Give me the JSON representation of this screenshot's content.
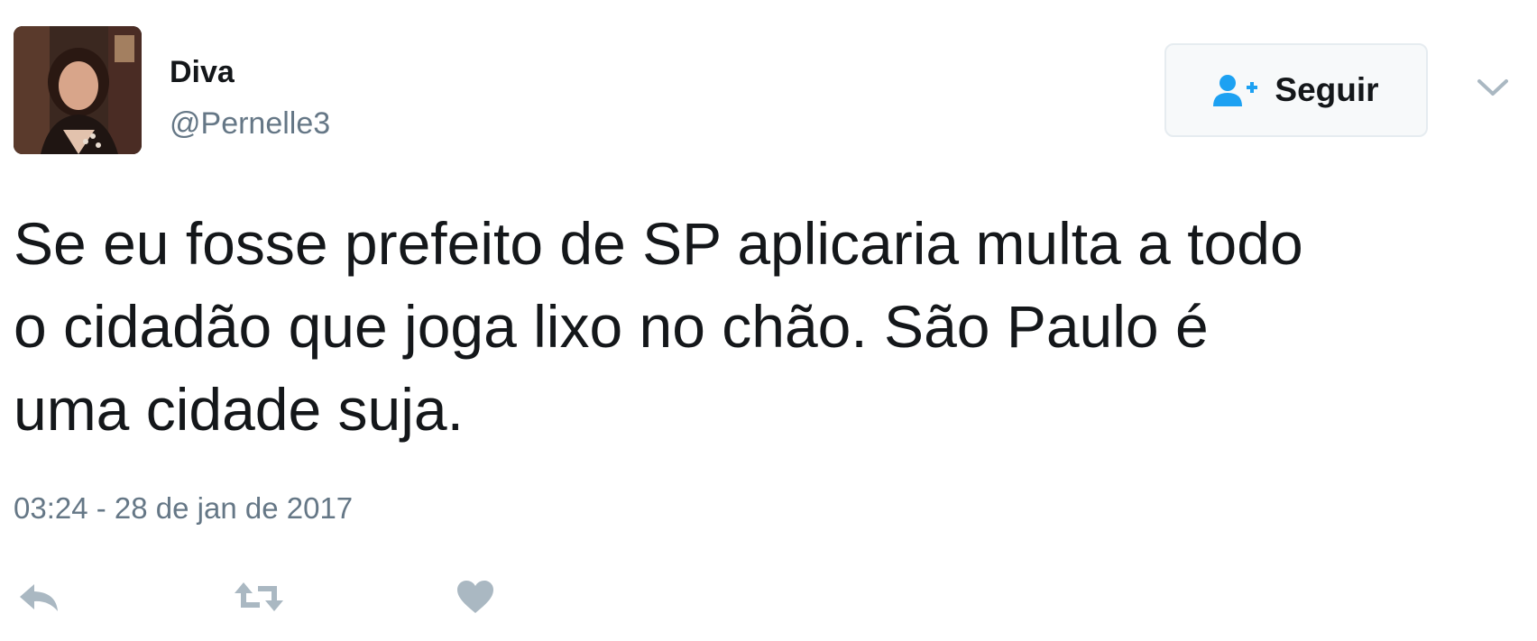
{
  "user": {
    "display_name": "Diva",
    "handle": "@Pernelle3"
  },
  "follow_button": {
    "label": "Seguir",
    "icon": "follow-user-icon",
    "icon_color": "#1da1f2"
  },
  "more_menu": {
    "icon": "chevron-down-icon"
  },
  "tweet": {
    "text": "Se eu fosse prefeito de SP aplicaria multa a todo\no cidadão que joga lixo no chão. São Paulo é\numa cidade suja.",
    "timestamp": "03:24 - 28 de jan de 2017"
  },
  "actions": [
    {
      "icon": "reply-icon"
    },
    {
      "icon": "retweet-icon"
    },
    {
      "icon": "heart-icon"
    }
  ],
  "colors": {
    "text_primary": "#14171a",
    "text_secondary": "#657786",
    "icon_gray": "#aab8c2",
    "accent_blue": "#1da1f2"
  }
}
